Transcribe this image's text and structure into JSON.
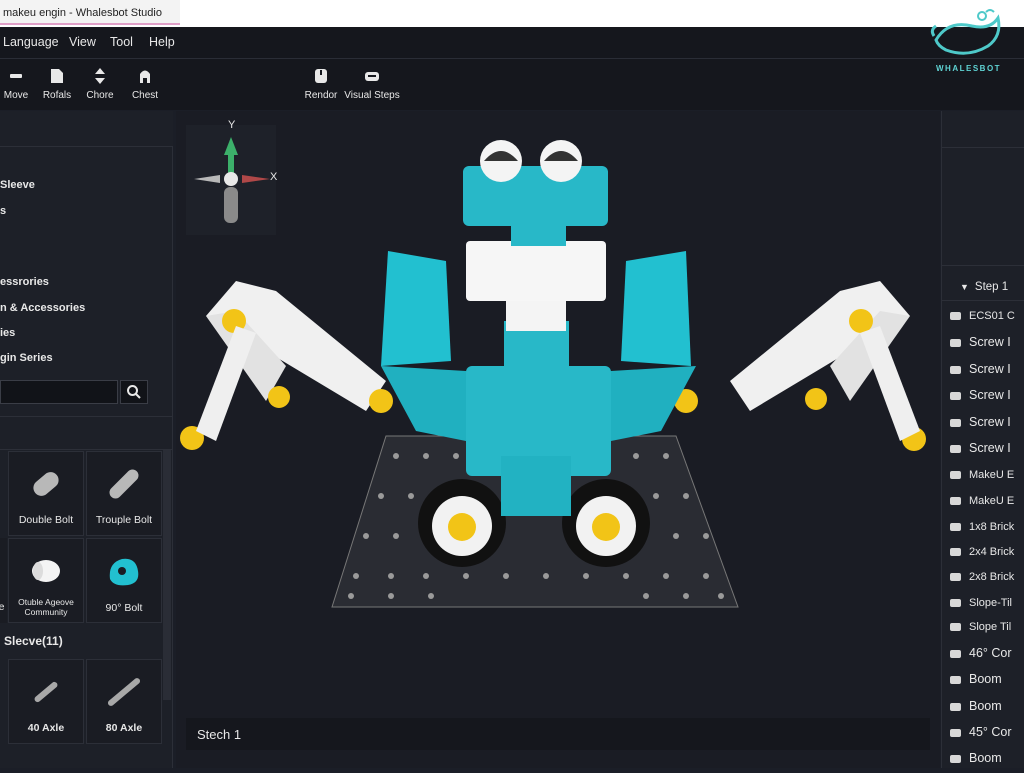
{
  "window": {
    "title": "makeu engin  - Whalesbot Studio"
  },
  "menu": [
    "Language",
    "View",
    "Tool",
    "Help"
  ],
  "logo": {
    "text": "WHALESBOT"
  },
  "toolbar": {
    "left": [
      {
        "label": "Move",
        "icon": "move-icon"
      },
      {
        "label": "Rofals",
        "icon": "file-icon"
      },
      {
        "label": "Chore",
        "icon": "chore-icon"
      },
      {
        "label": "Chest",
        "icon": "chest-icon"
      }
    ],
    "right": [
      {
        "label": "Rendor",
        "icon": "render-icon"
      },
      {
        "label": "Visual Steps",
        "icon": "visual-steps-icon"
      }
    ]
  },
  "left_panel": {
    "categories": [
      "Sleeve",
      "s",
      "essrories",
      "n & Accessories",
      "ies",
      "gin Series"
    ],
    "search_value": "",
    "parts": [
      {
        "label": "Double Bolt",
        "icon": "double-bolt-icon"
      },
      {
        "label": "Trouple Bolt",
        "icon": "trouple-bolt-icon"
      },
      {
        "label": "e",
        "icon": ""
      },
      {
        "label": "Otuble Ageove Community",
        "icon": "otuble-ageove-icon"
      },
      {
        "label": "90° Bolt",
        "icon": "90-bolt-icon"
      }
    ],
    "sleeve_section": "Slecve(11)",
    "axles": [
      {
        "label": "40 Axle",
        "icon": "40-axle-icon"
      },
      {
        "label": "80 Axle",
        "icon": "80-axle-icon"
      }
    ]
  },
  "viewport": {
    "axis_x": "X",
    "axis_y": "Y",
    "step_label": "Stech 1"
  },
  "right_panel": {
    "step_header": "Step 1",
    "items": [
      "ECS01 C",
      "Screw I",
      "Screw I",
      "Screw I",
      "Screw I",
      "Screw I",
      "MakeU E",
      "MakeU E",
      "1x8 Brick",
      "2x4 Brick",
      "2x8 Brick",
      "Slope-Til",
      "Slope Til",
      "46° Cor",
      "Boom",
      "Boom",
      "45° Cor",
      "Boom"
    ]
  },
  "colors": {
    "accent": "#22c0d0",
    "brick": "#28b8c8",
    "yellow": "#f2c417"
  }
}
